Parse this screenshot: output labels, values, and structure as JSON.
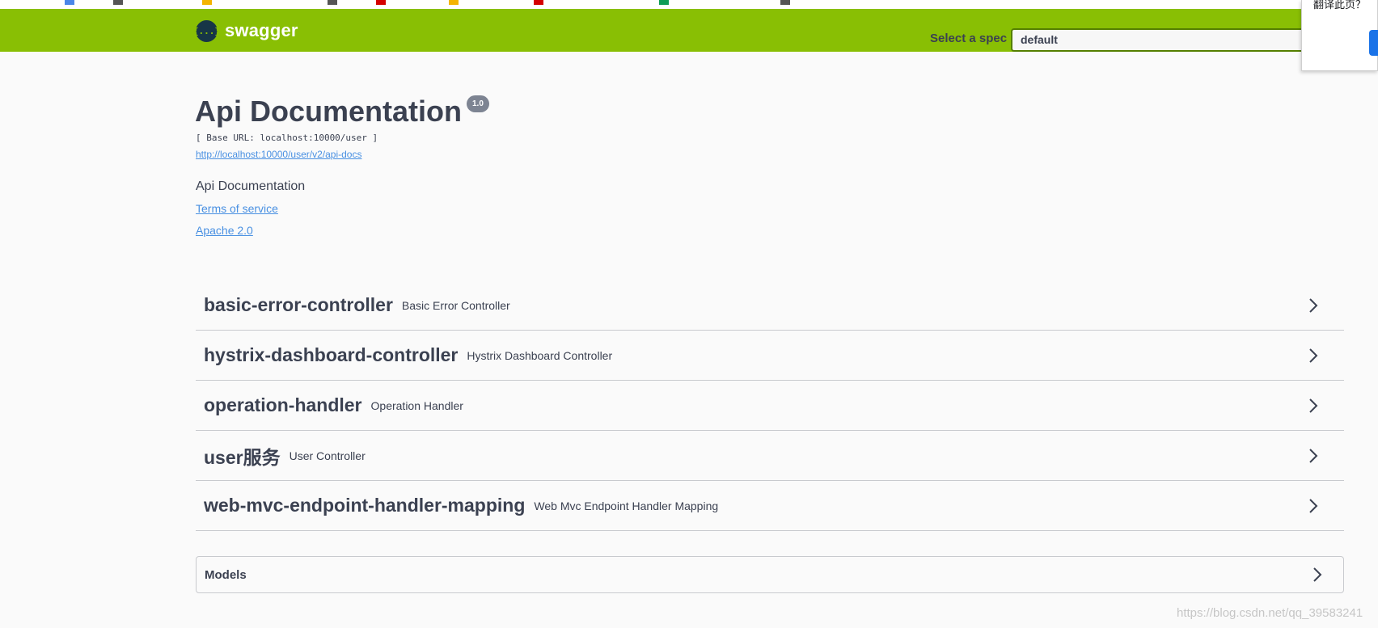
{
  "header": {
    "logo_text": "swagger",
    "logo_icon_glyph": "{...}",
    "spec_label": "Select a spec",
    "spec_selected": "default",
    "brand_color": "#89bf04"
  },
  "translate_popup": {
    "text": "翻译此页？"
  },
  "info": {
    "title": "Api Documentation",
    "version": "1.0",
    "base_url": "[ Base URL: localhost:10000/user ]",
    "api_docs_link": "http://localhost:10000/user/v2/api-docs",
    "description": "Api Documentation",
    "terms_link": "Terms of service",
    "license_link": "Apache 2.0"
  },
  "tags": [
    {
      "name": "basic-error-controller",
      "description": "Basic Error Controller"
    },
    {
      "name": "hystrix-dashboard-controller",
      "description": "Hystrix Dashboard Controller"
    },
    {
      "name": "operation-handler",
      "description": "Operation Handler"
    },
    {
      "name": "user服务",
      "description": "User Controller"
    },
    {
      "name": "web-mvc-endpoint-handler-mapping",
      "description": "Web Mvc Endpoint Handler Mapping"
    }
  ],
  "models": {
    "title": "Models"
  },
  "watermark": "https://blog.csdn.net/qq_39583241"
}
